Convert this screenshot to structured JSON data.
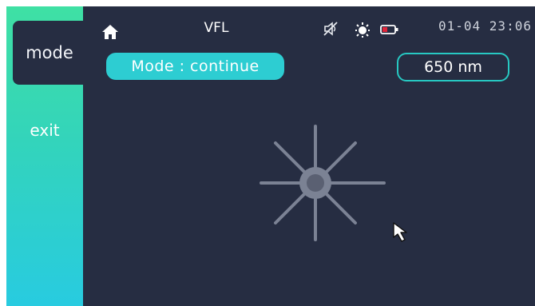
{
  "sidebar": {
    "mode_label": "mode",
    "exit_label": "exit"
  },
  "header": {
    "title": "VFL",
    "icons": [
      "home-icon",
      "sound-off-icon",
      "brightness-icon",
      "battery-icon"
    ],
    "clock": "01-04 23:06"
  },
  "main": {
    "mode_pill": "Mode : continue",
    "wavelength_pill": "650 nm",
    "laser_icon": "laser-burst-icon"
  },
  "colors": {
    "background": "#262d42",
    "accent": "#2dcdd2",
    "sidebar_gradient_top": "#3fe0a4",
    "sidebar_gradient_bottom": "#28cbe0",
    "battery_low": "#e0253a"
  }
}
